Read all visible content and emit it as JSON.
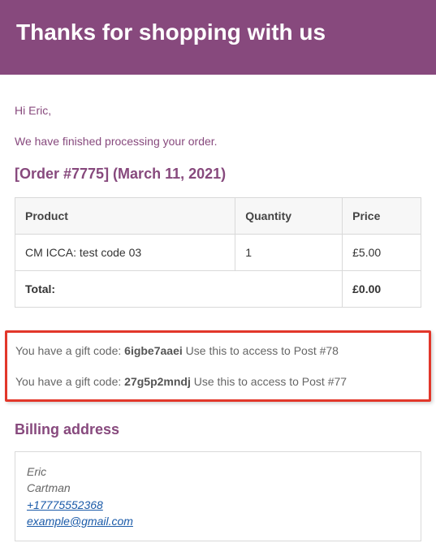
{
  "banner": {
    "title": "Thanks for shopping with us"
  },
  "greeting": "Hi Eric,",
  "intro": "We have finished processing your order.",
  "order": {
    "heading": "[Order #7775] (March 11, 2021)",
    "headers": {
      "product": "Product",
      "quantity": "Quantity",
      "price": "Price"
    },
    "items": [
      {
        "product": "CM ICCA: test code 03",
        "quantity": "1",
        "price": "£5.00"
      }
    ],
    "total_label": "Total:",
    "total_value": "£0.00"
  },
  "gift_codes": [
    {
      "prefix": "You have a gift code: ",
      "code": "6igbe7aaei",
      "suffix": " Use this to access to Post #78"
    },
    {
      "prefix": "You have a gift code: ",
      "code": "27g5p2mndj",
      "suffix": " Use this to access to Post #77"
    }
  ],
  "billing": {
    "heading": "Billing address",
    "first_name": "Eric",
    "last_name": "Cartman",
    "phone": "+17775552368",
    "email": "example@gmail.com"
  }
}
